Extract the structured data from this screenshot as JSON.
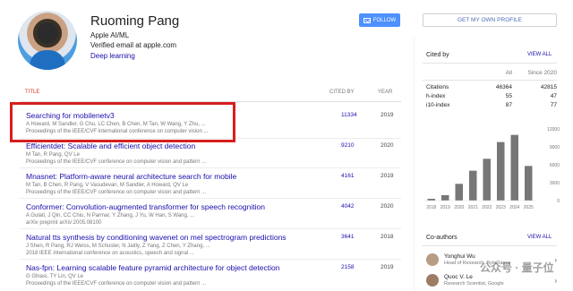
{
  "profile": {
    "name": "Ruoming Pang",
    "affiliation": "Apple AI/ML",
    "email": "Verified email at apple.com",
    "interest": "Deep learning",
    "follow_label": "FOLLOW",
    "my_profile_label": "GET MY OWN PROFILE"
  },
  "table": {
    "col_title": "TITLE",
    "col_cited": "CITED BY",
    "col_year": "YEAR",
    "rows": [
      {
        "title": "Searching for mobilenetv3",
        "authors": "A Howard, M Sandler, G Chu, LC Chen, B Chen, M Tan, W Wang, Y Zhu, ...",
        "venue": "Proceedings of the IEEE/CVF international conference on computer vision ...",
        "cited": "11334",
        "year": "2019"
      },
      {
        "title": "Efficientdet: Scalable and efficient object detection",
        "authors": "M Tan, R Pang, QV Le",
        "venue": "Proceedings of the IEEE/CVF conference on computer vision and pattern ...",
        "cited": "9210",
        "year": "2020"
      },
      {
        "title": "Mnasnet: Platform-aware neural architecture search for mobile",
        "authors": "M Tan, B Chen, R Pang, V Vasudevan, M Sandler, A Howard, QV Le",
        "venue": "Proceedings of the IEEE/CVF conference on computer vision and pattern ...",
        "cited": "4161",
        "year": "2019"
      },
      {
        "title": "Conformer: Convolution-augmented transformer for speech recognition",
        "authors": "A Gulati, J Qin, CC Chiu, N Parmar, Y Zhang, J Yu, W Han, S Wang, ...",
        "venue": "arXiv preprint arXiv:2005.08100",
        "cited": "4042",
        "year": "2020"
      },
      {
        "title": "Natural tts synthesis by conditioning wavenet on mel spectrogram predictions",
        "authors": "J Shen, R Pang, RJ Weiss, M Schuster, N Jaitly, Z Yang, Z Chen, Y Zhang, ...",
        "venue": "2018 IEEE international conference on acoustics, speech and signal ...",
        "cited": "3641",
        "year": "2018"
      },
      {
        "title": "Nas-fpn: Learning scalable feature pyramid architecture for object detection",
        "authors": "G Ghiasi, TY Lin, QV Le",
        "venue": "Proceedings of the IEEE/CVF conference on computer vision and pattern ...",
        "cited": "2158",
        "year": "2019"
      }
    ]
  },
  "cited_by": {
    "heading": "Cited by",
    "view_all": "VIEW ALL",
    "col_all": "All",
    "col_since": "Since 2020",
    "rows": [
      {
        "label": "Citations",
        "all": "46364",
        "since": "42815"
      },
      {
        "label": "h-index",
        "all": "55",
        "since": "47"
      },
      {
        "label": "i10-index",
        "all": "87",
        "since": "77"
      }
    ]
  },
  "chart_data": {
    "type": "bar",
    "categories": [
      "2018",
      "2019",
      "2020",
      "2021",
      "2022",
      "2023",
      "2024",
      "2025"
    ],
    "values": [
      300,
      900,
      2800,
      5000,
      7000,
      9800,
      11000,
      5800
    ],
    "ylim": [
      0,
      12000
    ],
    "yticks": [
      "0",
      "3000",
      "6000",
      "9000",
      "12000"
    ],
    "bar_color": "#777777",
    "grid": false
  },
  "coauthors": {
    "heading": "Co-authors",
    "view_all": "VIEW ALL",
    "items": [
      {
        "name": "Yonghui Wu",
        "role": "Head of Research, ByteDance"
      },
      {
        "name": "Quoc V. Le",
        "role": "Research Scientist, Google"
      }
    ]
  },
  "watermark": "公众号 · 量子位"
}
